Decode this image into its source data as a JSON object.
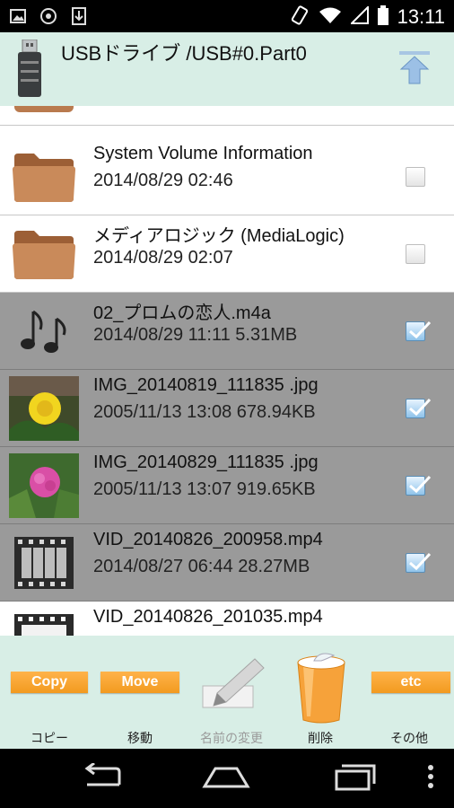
{
  "status_bar": {
    "time": "13:11",
    "left_icons": [
      "gallery-icon",
      "chrome-icon",
      "download-icon"
    ],
    "right_icons": [
      "rotate-icon",
      "wifi-icon",
      "signal-icon",
      "battery-icon"
    ]
  },
  "header": {
    "title": "USBドライブ /USB#0.Part0",
    "icon": "usb-drive-icon",
    "up_icon": "up-arrow-icon"
  },
  "files": [
    {
      "name": "System Volume Information",
      "meta": "2014/08/29 02:46",
      "type": "folder",
      "checked": false
    },
    {
      "name": "メディアロジック (MediaLogic)",
      "meta": "2014/08/29 02:07",
      "type": "folder",
      "checked": false
    },
    {
      "name": "02_プロムの恋人.m4a",
      "meta": "2014/08/29 11:11 5.31MB",
      "type": "audio",
      "checked": true
    },
    {
      "name": "IMG_20140819_111835 .jpg",
      "meta": "2005/11/13 13:08 678.94KB",
      "type": "image-yellow-flower",
      "checked": true
    },
    {
      "name": "IMG_20140829_111835 .jpg",
      "meta": "2005/11/13 13:07 919.65KB",
      "type": "image-pink-flower",
      "checked": true
    },
    {
      "name": "VID_20140826_200958.mp4",
      "meta": "2014/08/27 06:44 28.27MB",
      "type": "video",
      "checked": true
    },
    {
      "name": "VID_20140826_201035.mp4",
      "meta": "",
      "type": "video",
      "checked": false
    }
  ],
  "toolbar": {
    "copy_btn": "Copy",
    "copy_label": "コピー",
    "move_btn": "Move",
    "move_label": "移動",
    "rename_label": "名前の変更",
    "delete_label": "削除",
    "etc_btn": "etc",
    "etc_label": "その他"
  },
  "colors": {
    "header_bg": "#d8eee6",
    "selected_row": "#9a9a9a",
    "button_orange": "#f5a02a"
  }
}
